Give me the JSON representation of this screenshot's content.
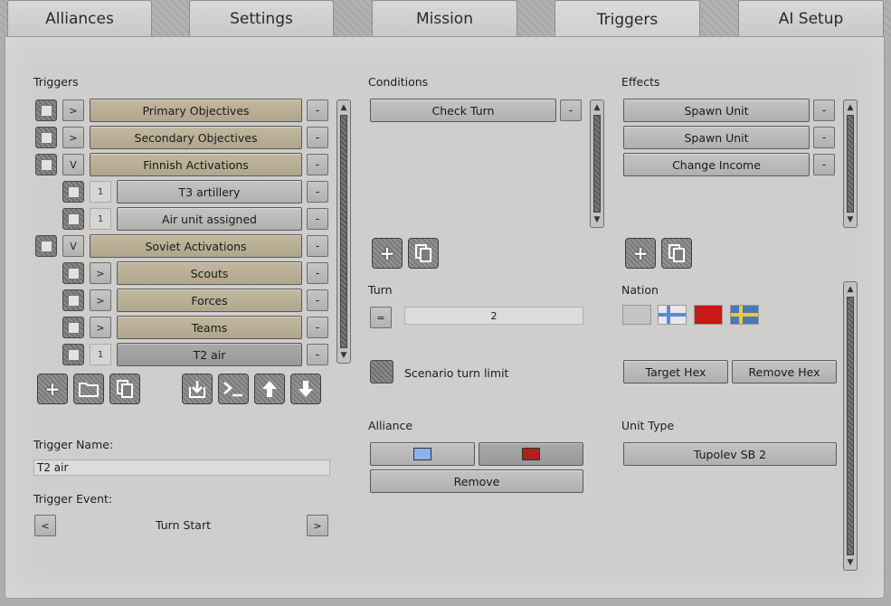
{
  "tabs": [
    {
      "label": "Alliances"
    },
    {
      "label": "Settings"
    },
    {
      "label": "Mission"
    },
    {
      "label": "Triggers"
    },
    {
      "label": "AI Setup"
    }
  ],
  "active_tab": "Triggers",
  "triggers": {
    "heading": "Triggers",
    "rows": [
      {
        "toggle": ">",
        "label": "Primary Objectives"
      },
      {
        "toggle": ">",
        "label": "Secondary Objectives"
      },
      {
        "toggle": "V",
        "label": "Finnish Activations"
      },
      {
        "toggle": "1",
        "label": "T3 artillery"
      },
      {
        "toggle": "1",
        "label": "Air unit assigned"
      },
      {
        "toggle": "V",
        "label": "Soviet Activations"
      },
      {
        "toggle": ">",
        "label": "Scouts"
      },
      {
        "toggle": ">",
        "label": "Forces"
      },
      {
        "toggle": ">",
        "label": "Teams"
      },
      {
        "toggle": "1",
        "label": "T2 air"
      }
    ],
    "remove_label": "-",
    "name_label": "Trigger Name:",
    "name_value": "T2 air",
    "event_label": "Trigger Event:",
    "event_value": "Turn Start",
    "event_prev": "<",
    "event_next": ">"
  },
  "conditions": {
    "heading": "Conditions",
    "items": [
      {
        "label": "Check Turn"
      }
    ],
    "turn_label": "Turn",
    "turn_operator": "=",
    "turn_value": "2",
    "scenario_limit_label": "Scenario turn limit",
    "alliance_label": "Alliance",
    "alliance_colors": [
      "#8ab4f0",
      "#b02020"
    ],
    "remove_label": "Remove"
  },
  "effects": {
    "heading": "Effects",
    "items": [
      {
        "label": "Spawn Unit"
      },
      {
        "label": "Spawn Unit"
      },
      {
        "label": "Change Income"
      }
    ],
    "nation_label": "Nation",
    "target_hex_label": "Target Hex",
    "remove_hex_label": "Remove Hex",
    "unit_type_label": "Unit Type",
    "unit_type_value": "Tupolev SB 2"
  },
  "icons": {
    "add": "plus-icon",
    "copy": "copy-icon",
    "folder": "folder-icon",
    "import": "import-icon",
    "console": "console-icon",
    "up": "arrow-up-icon",
    "down": "arrow-down-icon"
  }
}
